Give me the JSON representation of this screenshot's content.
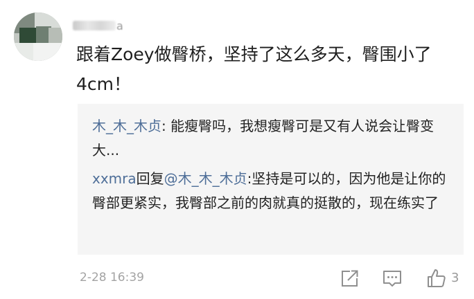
{
  "comment": {
    "author_visible_suffix": "a",
    "text": "跟着Zoey做臀桥，坚持了这么多天，臀围小了4cm！"
  },
  "replies": [
    {
      "nickname": "木_木_木贞",
      "text": ": 能瘦臀吗，我想瘦臀可是又有人说会让臀变大..."
    },
    {
      "nickname": "xxmra",
      "action": "回复",
      "mention": "@木_木_木贞",
      "text": ":坚持是可以的，因为他是让你的臀部更紧实，我臀部之前的肉就真的挺散的，现在练实了"
    }
  ],
  "footer": {
    "timestamp": "2-28 16:39",
    "like_count": "3",
    "icons": [
      "share-icon",
      "comment-icon",
      "thumbs-up-icon"
    ]
  },
  "colors": {
    "nickname": "#4e6e98",
    "reply_background": "#f5f5f5",
    "meta_text": "#a3a3a3",
    "body_text": "#1e1e1e"
  }
}
